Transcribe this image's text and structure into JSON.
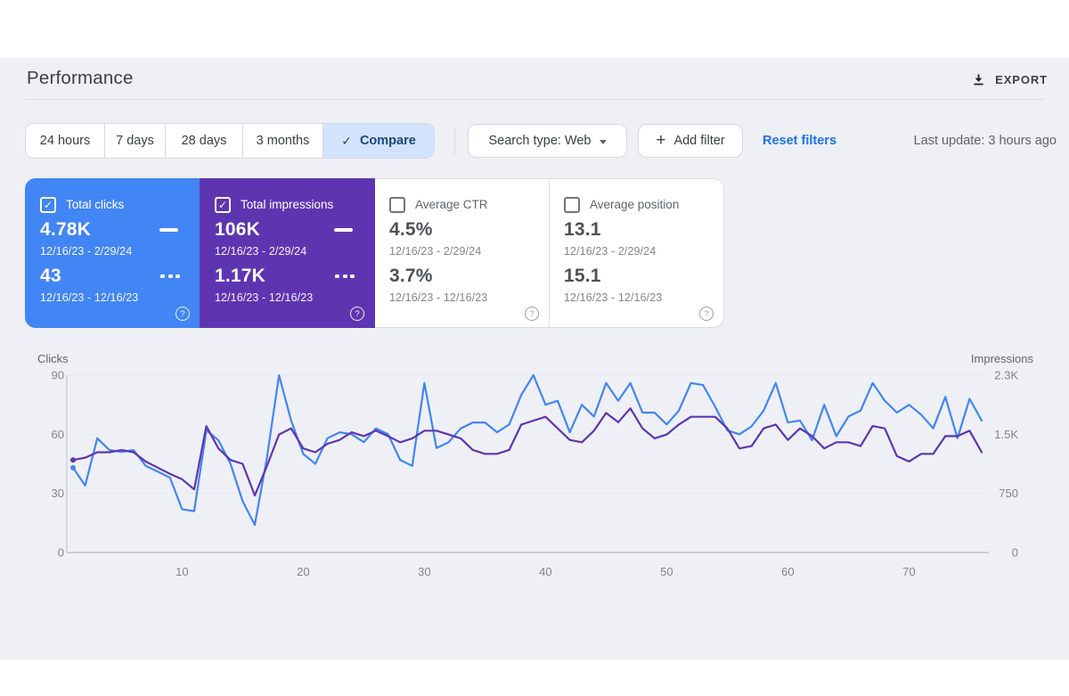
{
  "page": {
    "title": "Performance",
    "export_label": "EXPORT",
    "last_update": "Last update: 3 hours ago"
  },
  "icons": {
    "check": "✓",
    "plus": "+",
    "help": "?"
  },
  "filters": {
    "date_tabs": [
      {
        "label": "24 hours",
        "selected": false
      },
      {
        "label": "7 days",
        "selected": false
      },
      {
        "label": "28 days",
        "selected": false
      },
      {
        "label": "3 months",
        "selected": false
      },
      {
        "label": "Compare",
        "selected": true
      }
    ],
    "search_type_label": "Search type: Web",
    "add_filter_label": "Add filter",
    "reset_label": "Reset filters"
  },
  "metric_cards": [
    {
      "label": "Total clicks",
      "checked": true,
      "accent": "#4285f4",
      "primary": {
        "value": "4.78K",
        "range": "12/16/23 - 2/29/24"
      },
      "secondary": {
        "value": "43",
        "range": "12/16/23 - 12/16/23"
      }
    },
    {
      "label": "Total impressions",
      "checked": true,
      "accent": "#5e35b1",
      "primary": {
        "value": "106K",
        "range": "12/16/23 - 2/29/24"
      },
      "secondary": {
        "value": "1.17K",
        "range": "12/16/23 - 12/16/23"
      }
    },
    {
      "label": "Average CTR",
      "checked": false,
      "accent": null,
      "primary": {
        "value": "4.5%",
        "range": "12/16/23 - 2/29/24"
      },
      "secondary": {
        "value": "3.7%",
        "range": "12/16/23 - 12/16/23"
      }
    },
    {
      "label": "Average position",
      "checked": false,
      "accent": null,
      "primary": {
        "value": "13.1",
        "range": "12/16/23 - 2/29/24"
      },
      "secondary": {
        "value": "15.1",
        "range": "12/16/23 - 12/16/23"
      }
    }
  ],
  "chart_data": {
    "type": "line",
    "title": "Clicks and impressions over time, 12/16/23 - 2/29/24",
    "x_count": 76,
    "x_tick_indices": [
      10,
      20,
      30,
      40,
      50,
      60,
      70
    ],
    "x_tick_labels": [
      "10",
      "20",
      "30",
      "40",
      "50",
      "60",
      "70"
    ],
    "left_axis": {
      "title": "Clicks",
      "max": 90,
      "tick_values": [
        0,
        30,
        60,
        90
      ],
      "tick_labels": [
        "0",
        "30",
        "60",
        "90"
      ]
    },
    "right_axis": {
      "title": "Impressions",
      "max": 2300,
      "tick_values": [
        0,
        750,
        1500,
        2300
      ],
      "tick_labels": [
        "0",
        "750",
        "1.5K",
        "2.3K"
      ]
    },
    "grid": true,
    "legend_position": "none",
    "series": [
      {
        "name": "Total clicks",
        "axis": "left",
        "color": "#4285f4",
        "date_range": "12/16/23 - 2/29/24",
        "values": [
          43,
          34,
          58,
          52,
          51,
          52,
          44,
          41,
          38,
          22,
          21,
          62,
          57,
          45,
          26,
          14,
          48,
          90,
          67,
          50,
          45,
          58,
          61,
          60,
          56,
          63,
          60,
          47,
          44,
          86,
          53,
          56,
          63,
          66,
          66,
          61,
          65,
          80,
          90,
          75,
          77,
          61,
          75,
          69,
          86,
          77,
          86,
          71,
          71,
          65,
          72,
          86,
          85,
          74,
          62,
          60,
          64,
          72,
          86,
          66,
          67,
          57,
          75,
          59,
          69,
          72,
          86,
          77,
          71,
          75,
          70,
          63,
          79,
          58,
          78,
          67
        ]
      },
      {
        "name": "Total impressions",
        "axis": "right",
        "color": "#5e35b1",
        "date_range": "12/16/23 - 2/29/24",
        "values": [
          1200,
          1230,
          1300,
          1300,
          1330,
          1300,
          1180,
          1100,
          1020,
          950,
          820,
          1640,
          1350,
          1200,
          1150,
          740,
          1120,
          1530,
          1610,
          1350,
          1300,
          1410,
          1460,
          1560,
          1510,
          1580,
          1510,
          1430,
          1480,
          1580,
          1580,
          1530,
          1480,
          1330,
          1280,
          1280,
          1330,
          1660,
          1710,
          1760,
          1610,
          1460,
          1430,
          1580,
          1810,
          1690,
          1870,
          1610,
          1480,
          1530,
          1660,
          1760,
          1760,
          1760,
          1610,
          1350,
          1380,
          1610,
          1660,
          1460,
          1610,
          1510,
          1350,
          1430,
          1430,
          1380,
          1640,
          1610,
          1250,
          1180,
          1280,
          1280,
          1510,
          1510,
          1580,
          1300
        ]
      }
    ]
  }
}
